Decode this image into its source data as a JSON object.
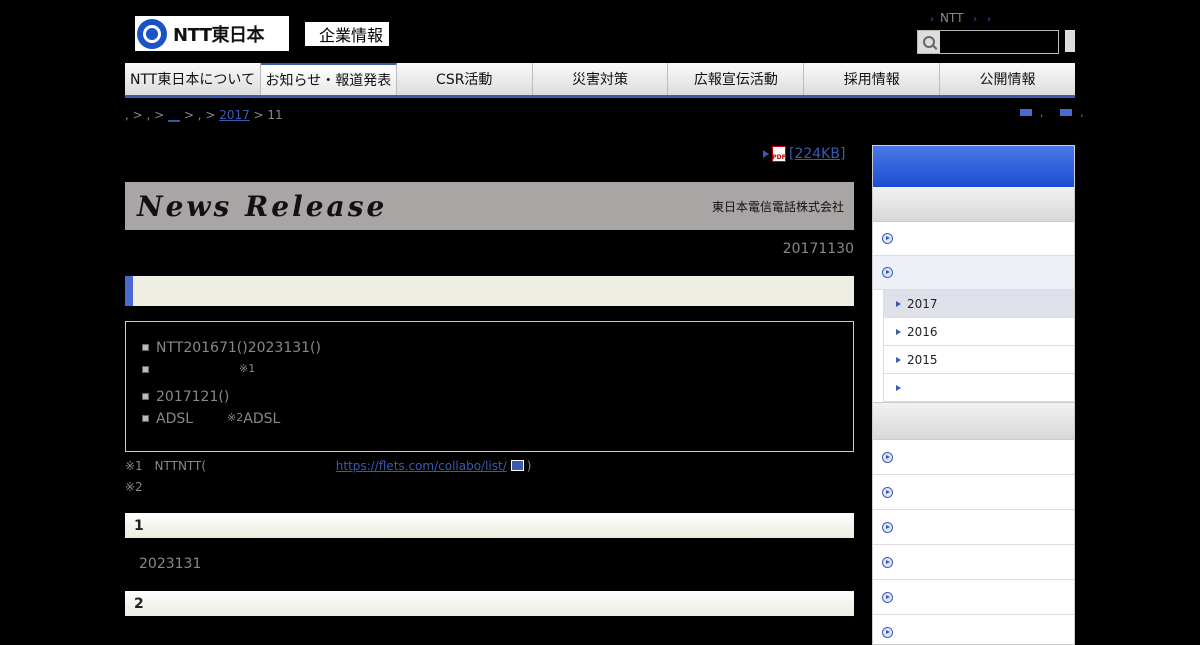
{
  "header": {
    "logo_text": "NTT東日本",
    "corp_label": "企業情報",
    "util_link_1": "NTT",
    "search": {
      "placeholder": "",
      "value": ""
    }
  },
  "gnav": {
    "items": [
      {
        "label": "NTT東日本について"
      },
      {
        "label": "お知らせ・報道発表"
      },
      {
        "label": "CSR活動"
      },
      {
        "label": "災害対策"
      },
      {
        "label": "広報宣伝活動"
      },
      {
        "label": "採用情報"
      },
      {
        "label": "公開情報"
      }
    ]
  },
  "breadcrumb": {
    "lead": ", > , > ",
    "link_blank": "__",
    "mid": " > , > ",
    "year_link": "2017",
    "tail": " > 11"
  },
  "pdf": {
    "size": "[224KB]"
  },
  "release": {
    "title": "News Release",
    "company": "東日本電信電話株式会社",
    "date": "20171130"
  },
  "summary": {
    "bullet_1": "NTT201671()2023131()",
    "bullet_2_sup": "※1",
    "bullet_3": "2017121()",
    "bullet_4_pre": "ADSL",
    "bullet_4_sup": "※2",
    "bullet_4_post": "ADSL"
  },
  "notes": {
    "note_1_label": "※1",
    "note_1_text": "NTTNTT(",
    "note_1_link": "https://flets.com/collabo/list/",
    "note_1_close": ")",
    "note_2_label": "※2"
  },
  "sections": [
    {
      "heading": "1",
      "body": "2023131"
    },
    {
      "heading": "2"
    }
  ],
  "sidebar": {
    "sub_items": [
      {
        "label": "2017"
      },
      {
        "label": "2016"
      },
      {
        "label": "2015"
      },
      {
        "label": ""
      }
    ]
  }
}
